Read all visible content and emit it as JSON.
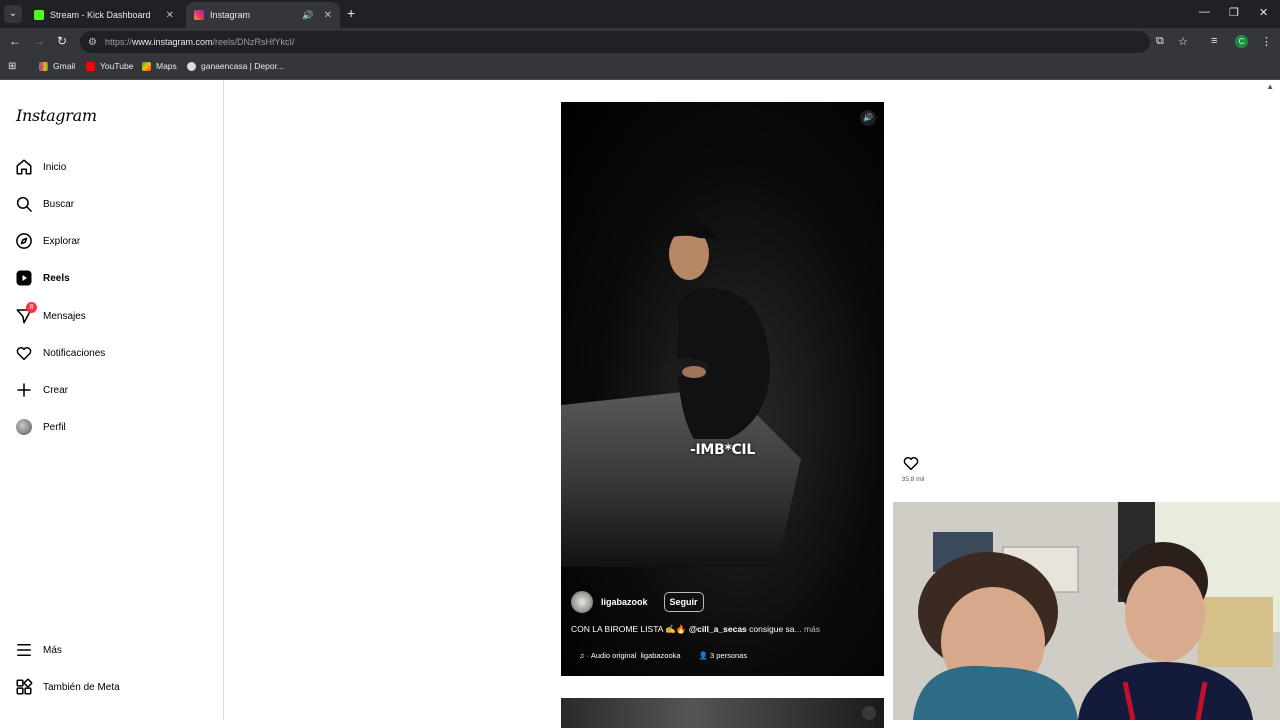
{
  "browser": {
    "tabs": [
      {
        "title": "Stream - Kick Dashboard",
        "active": false
      },
      {
        "title": "Instagram",
        "active": true
      }
    ],
    "url_prefix": "https://",
    "url_host": "www.instagram.com",
    "url_path": "/reels/DNzRsHfYkcI/",
    "bookmarks": [
      "Gmail",
      "YouTube",
      "Maps",
      "ganaencasa | Depor..."
    ],
    "profile_initial": "C"
  },
  "instagram": {
    "logo": "Instagram",
    "nav": [
      {
        "label": "Inicio",
        "icon": "home-icon"
      },
      {
        "label": "Buscar",
        "icon": "search-icon"
      },
      {
        "label": "Explorar",
        "icon": "compass-icon"
      },
      {
        "label": "Reels",
        "icon": "reels-icon"
      },
      {
        "label": "Mensajes",
        "icon": "messenger-icon",
        "badge": "8"
      },
      {
        "label": "Notificaciones",
        "icon": "heart-icon"
      },
      {
        "label": "Crear",
        "icon": "plus-icon"
      },
      {
        "label": "Perfil",
        "icon": "avatar"
      }
    ],
    "bottom_nav": [
      {
        "label": "Más",
        "icon": "menu-icon"
      },
      {
        "label": "También de Meta",
        "icon": "meta-grid-icon"
      }
    ]
  },
  "reel": {
    "subtitle": "-IMB*CIL",
    "username": "ligabazook",
    "follow_label": "Seguir",
    "caption_text": "CON LA BIROME LISTA ✍️🔥",
    "caption_mention": "@cill_a_secas",
    "caption_rest": "consigue sa",
    "caption_more": "... más",
    "audio_label": "· Audio original",
    "audio_user": "ligabazooka",
    "tagged_people": "3 personas",
    "likes": "35,8 mil"
  }
}
